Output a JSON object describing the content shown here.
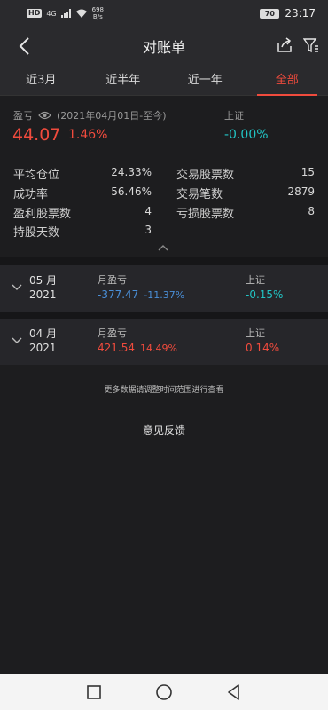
{
  "status_bar": {
    "hd_badge": "HD",
    "network": "4G",
    "speed_value": "698",
    "speed_unit": "B/s",
    "battery": "70",
    "time": "23:17"
  },
  "nav": {
    "title": "对账单",
    "back_icon": "chevron-left-icon",
    "share_icon": "share-icon",
    "filter_icon": "filter-icon"
  },
  "tabs": [
    {
      "label": "近3月",
      "active": false
    },
    {
      "label": "近半年",
      "active": false
    },
    {
      "label": "近一年",
      "active": false
    },
    {
      "label": "全部",
      "active": true
    }
  ],
  "summary": {
    "pl_label": "盈亏",
    "date_range": "(2021年04月01日-至今)",
    "pl_value": "44.07",
    "pl_pct": "1.46%",
    "index_label": "上证",
    "index_value": "-0.00%",
    "stats_left": [
      {
        "label": "平均仓位",
        "value": "24.33%"
      },
      {
        "label": "成功率",
        "value": "56.46%"
      },
      {
        "label": "盈利股票数",
        "value": "4"
      },
      {
        "label": "持股天数",
        "value": "3"
      }
    ],
    "stats_right": [
      {
        "label": "交易股票数",
        "value": "15"
      },
      {
        "label": "交易笔数",
        "value": "2879"
      },
      {
        "label": "亏损股票数",
        "value": "8"
      }
    ]
  },
  "months": [
    {
      "month": "05 月",
      "year": "2021",
      "pl_label": "月盈亏",
      "amount": "-377.47",
      "pct": "-11.37%",
      "index_label": "上证",
      "index_value": "-0.15%"
    },
    {
      "month": "04 月",
      "year": "2021",
      "pl_label": "月盈亏",
      "amount": "421.54",
      "pct": "14.49%",
      "index_label": "上证",
      "index_value": "0.14%"
    }
  ],
  "hint": "更多数据请调整时间范围进行查看",
  "feedback": "意见反馈",
  "colors": {
    "accent_red": "#f04b3d",
    "negative_blue": "#4a8fd8",
    "index_cyan": "#22c4c4",
    "background": "#1d1d1f"
  }
}
